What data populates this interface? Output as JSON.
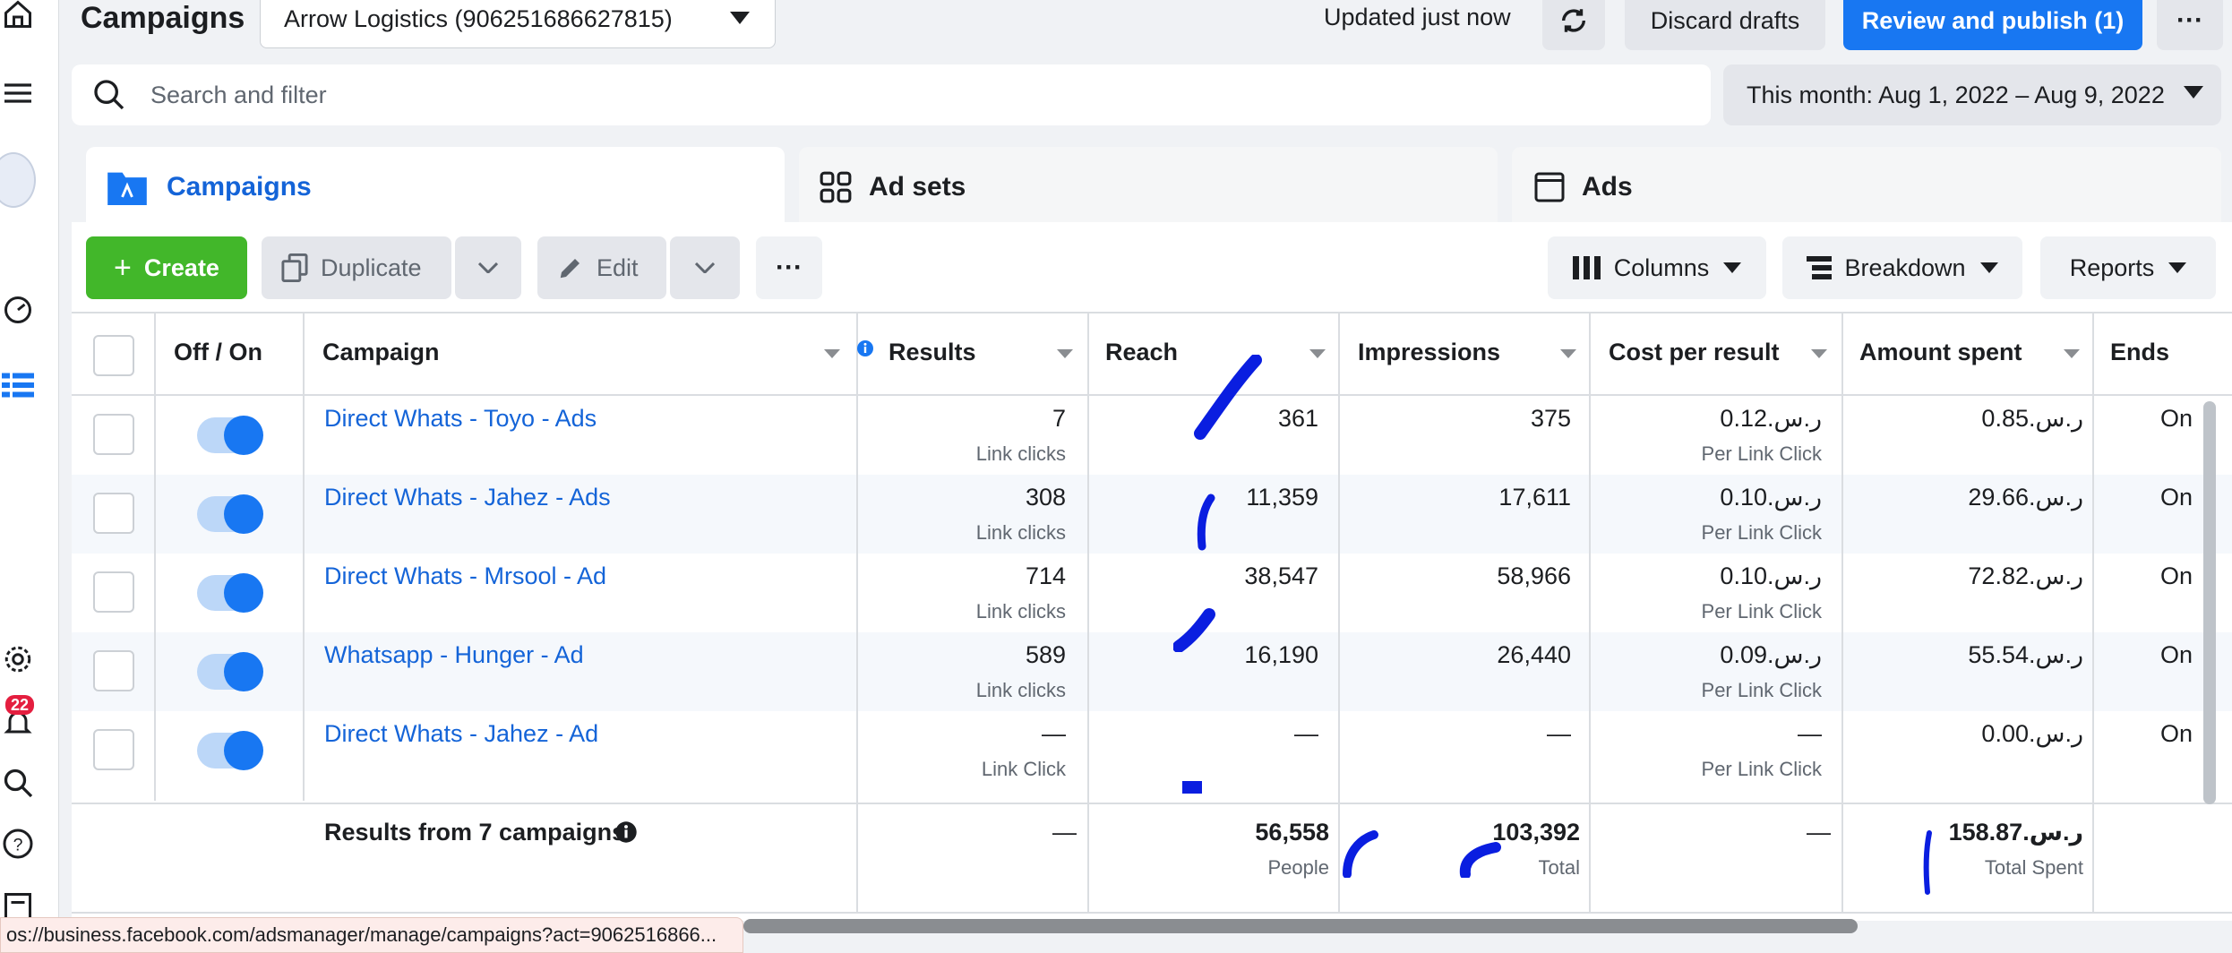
{
  "header": {
    "title": "Campaigns",
    "account": "Arrow Logistics (906251686627815)",
    "updated": "Updated just now",
    "discard": "Discard drafts",
    "publish": "Review and publish (1)"
  },
  "search": {
    "placeholder": "Search and filter"
  },
  "date_range": "This month: Aug 1, 2022 – Aug 9, 2022",
  "tabs": [
    "Campaigns",
    "Ad sets",
    "Ads"
  ],
  "toolbar": {
    "create": "Create",
    "duplicate": "Duplicate",
    "edit": "Edit",
    "columns": "Columns",
    "breakdown": "Breakdown",
    "reports": "Reports"
  },
  "columns": [
    "Off / On",
    "Campaign",
    "Results",
    "Reach",
    "Impressions",
    "Cost per result",
    "Amount spent",
    "Ends"
  ],
  "rows": [
    {
      "name": "Direct Whats - Toyo - Ads",
      "results": "7",
      "results_sub": "Link clicks",
      "reach": "361",
      "impressions": "375",
      "cpr": "ر.س.0.12",
      "cpr_sub": "Per Link Click",
      "spent": "ر.س.0.85",
      "ends": "On"
    },
    {
      "name": "Direct Whats - Jahez - Ads",
      "results": "308",
      "results_sub": "Link clicks",
      "reach": "11,359",
      "impressions": "17,611",
      "cpr": "ر.س.0.10",
      "cpr_sub": "Per Link Click",
      "spent": "ر.س.29.66",
      "ends": "On"
    },
    {
      "name": "Direct Whats - Mrsool - Ad",
      "results": "714",
      "results_sub": "Link clicks",
      "reach": "38,547",
      "impressions": "58,966",
      "cpr": "ر.س.0.10",
      "cpr_sub": "Per Link Click",
      "spent": "ر.س.72.82",
      "ends": "On"
    },
    {
      "name": "Whatsapp - Hunger - Ad",
      "results": "589",
      "results_sub": "Link clicks",
      "reach": "16,190",
      "impressions": "26,440",
      "cpr": "ر.س.0.09",
      "cpr_sub": "Per Link Click",
      "spent": "ر.س.55.54",
      "ends": "On"
    },
    {
      "name": "Direct Whats - Jahez - Ad",
      "results": "—",
      "results_sub": "Link Click",
      "reach": "—",
      "impressions": "—",
      "cpr": "—",
      "cpr_sub": "Per Link Click",
      "spent": "ر.س.0.00",
      "ends": "On"
    }
  ],
  "totals": {
    "label": "Results from 7 campaigns",
    "results": "—",
    "reach": "56,558",
    "reach_sub": "People",
    "impressions": "103,392",
    "impressions_sub": "Total",
    "cpr": "—",
    "spent": "ر.س.158.87",
    "spent_sub": "Total Spent"
  },
  "notifications_badge": "22",
  "status_url": "os://business.facebook.com/adsmanager/manage/campaigns?act=9062516866...",
  "colors": {
    "brand": "#1877f2",
    "create": "#42b72a",
    "link": "#1464d8",
    "scribble": "#0a1ee0"
  }
}
